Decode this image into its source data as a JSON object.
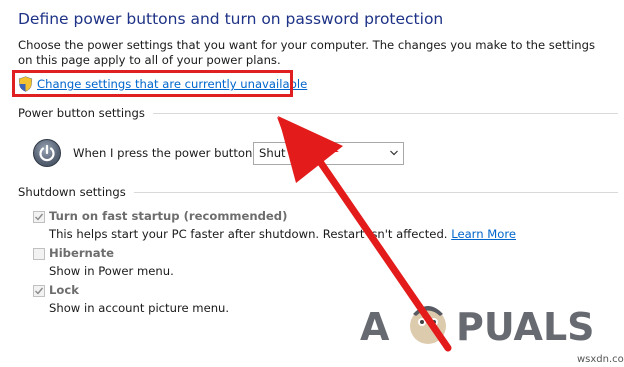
{
  "header": {
    "title": "Define power buttons and turn on password protection",
    "description": "Choose the power settings that you want for your computer. The changes you make to the settings on this page apply to all of your power plans.",
    "uac_link": "Change settings that are currently unavailable"
  },
  "power_button_settings": {
    "heading": "Power button settings",
    "label": "When I press the power button:",
    "selected_value": "Shut down"
  },
  "shutdown_settings": {
    "heading": "Shutdown settings",
    "items": [
      {
        "label": "Turn on fast startup (recommended)",
        "checked": true,
        "description": "This helps start your PC faster after shutdown. Restart isn't affected.",
        "link": "Learn More"
      },
      {
        "label": "Hibernate",
        "checked": false,
        "description": "Show in Power menu."
      },
      {
        "label": "Lock",
        "checked": true,
        "description": "Show in account picture menu."
      }
    ]
  },
  "watermark": {
    "brand": "APPUALS",
    "site": "wsxdn.com"
  },
  "colors": {
    "title": "#1e3287",
    "link": "#0066cc",
    "highlight": "#e02020",
    "arrow": "#e31b1b"
  }
}
